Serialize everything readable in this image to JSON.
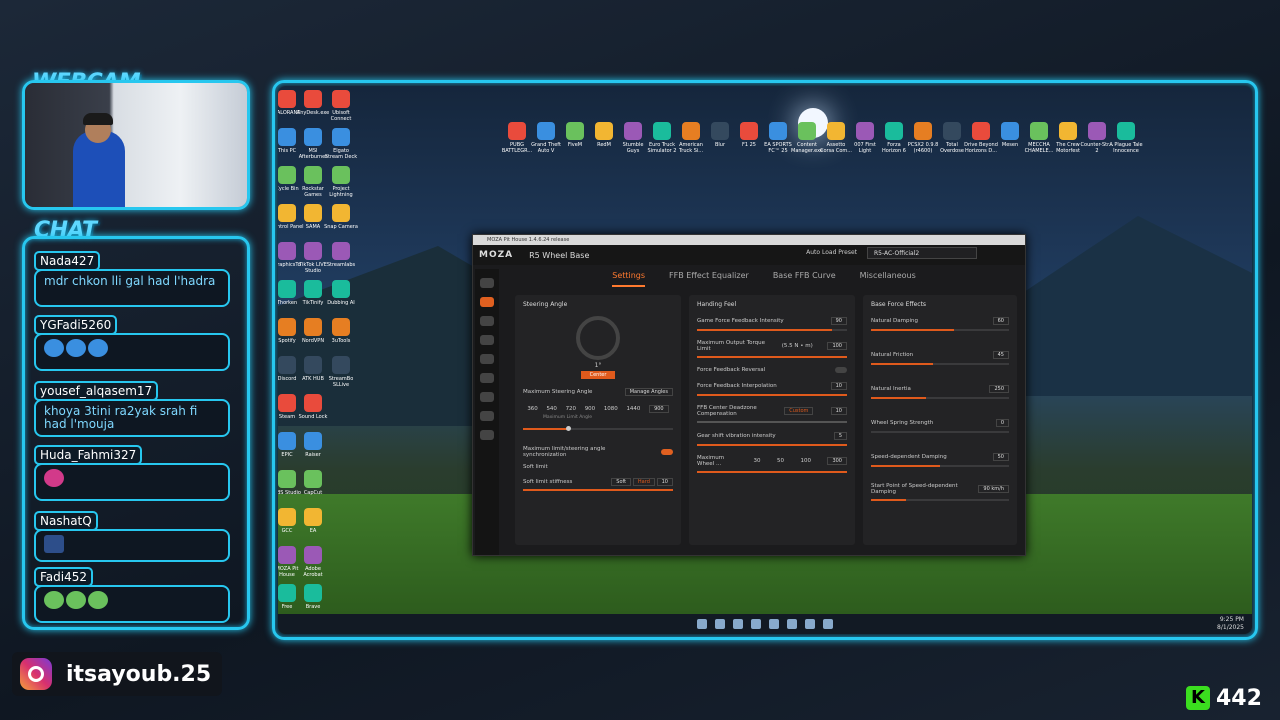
{
  "overlay": {
    "webcam_label": "WEBCAM",
    "chat_label": "CHAT",
    "instagram_handle": "itsayoub.25",
    "kick_count": "442",
    "accent": "#27c7ef"
  },
  "chat": [
    {
      "user": "Nada427",
      "text": "mdr chkon lli gal had l'hadra"
    },
    {
      "user": "YGFadi5260",
      "text": ""
    },
    {
      "user": "yousef_alqasem17",
      "text": "khoya 3tini ra2yak srah fi had l'mouja"
    },
    {
      "user": "Huda_Fahmi327",
      "text": ""
    },
    {
      "user": "NashatQ",
      "text": ""
    },
    {
      "user": "Fadi452",
      "text": ""
    }
  ],
  "desktop_left_icons": [
    "VALORANT",
    "This PC",
    "Cycle Bin",
    "Control Panel",
    "GraphicsTo",
    "Thorken",
    "Spotify",
    "Discord",
    "Steam",
    "EPIC",
    "OBS Studio",
    "GCC",
    "MOZA Pit House",
    "Free"
  ],
  "desktop_col2_icons": [
    "AnyDesk.exe",
    "MSI Afterburner",
    "Rockstar Games",
    "SAMA",
    "TikTok LIVE Studio",
    "TikTinify",
    "NordVPN",
    "ATK HUB",
    "Sound Lock",
    "Raiser",
    "CapCut",
    "EA",
    "Adobe Acrobat",
    "Brave"
  ],
  "desktop_col3_icons": [
    "Ubisoft Connect",
    "Elgato Stream Deck",
    "Project Lightning",
    "Snap Camera",
    "Streamlabs",
    "Dubbing AI",
    "3uTools",
    "StreamBo SLLive"
  ],
  "desktop_top_icons": [
    "PUBG BATTLEGR...",
    "Grand Theft Auto V",
    "FiveM",
    "RedM",
    "Stumble Guys",
    "Euro Truck Simulator 2",
    "American Truck Si...",
    "Blur",
    "F1 25",
    "EA SPORTS FC™ 25",
    "Content Manager.exe",
    "Assetto Corsa Com...",
    "007 First Light",
    "Forza Horizon 6",
    "PCSX2 0.9.8 (r4600)",
    "Total Overdose",
    "Drive Beyond Horizons D...",
    "Mesen",
    "MECCHA CHAMELE...",
    "The Crew Motorfest",
    "Counter-Str... 2",
    "A Plague Tale Innocence"
  ],
  "app": {
    "window_title": "MOZA Pit House 1.4.6.24 release",
    "logo": "MOZA",
    "device": "R5 Wheel Base",
    "auto_load_label": "Auto Load Preset",
    "preset": "R5-AC-Official2",
    "tabs": [
      "Settings",
      "FFB Effect Equalizer",
      "Base FFB Curve",
      "Miscellaneous"
    ],
    "steering": {
      "title": "Steering Angle",
      "angle": "1°",
      "center_btn": "Center",
      "max_label": "Maximum Steering Angle",
      "manage": "Manage Angles",
      "presets": [
        "360",
        "540",
        "720",
        "900",
        "1080",
        "1440",
        "900"
      ],
      "tooltip": "Maximum Limit Angle",
      "sync_label": "Maximum limit/steering angle synchronization",
      "soft_limit": "Soft limit",
      "soft_stiff": "Soft limit stiffness",
      "soft_opt": "Soft",
      "hard_opt": "Hard",
      "soft_val": "10",
      "max_angle_level": 0.3
    },
    "handing": {
      "title": "Handing Feel",
      "game_ffb": "Game Force Feedback Intensity",
      "game_ffb_val": "90",
      "game_ffb_level": 0.9,
      "max_torque": "Maximum Output Torque Limit",
      "max_torque_val": "(5.5 N • m)",
      "max_torque_num": "100",
      "max_torque_level": 1.0,
      "reversal": "Force Feedback Reversal",
      "interp": "Force Feedback Interpolation",
      "interp_val": "10",
      "interp_level": 1.0,
      "deadzone": "FFB Center Deadzone Compensation",
      "deadzone_opt": "Custom",
      "deadzone_val": "10",
      "deadzone_level": 1.0,
      "gear": "Gear shift vibration intensity",
      "gear_val": "5",
      "gear_level": 1.0,
      "max_wheel": "Maximum Wheel ...",
      "max_wheel_opts": [
        "30",
        "50",
        "100",
        "300"
      ],
      "max_wheel_level": 1.0
    },
    "base": {
      "title": "Base Force Effects",
      "damping": "Natural Damping",
      "damping_val": "60",
      "damping_level": 0.6,
      "friction": "Natural Friction",
      "friction_val": "45",
      "friction_level": 0.45,
      "inertia": "Natural Inertia",
      "inertia_val": "250",
      "inertia_level": 0.4,
      "spring": "Wheel Spring Strength",
      "spring_val": "0",
      "spring_level": 0.0,
      "speed_damp": "Speed-dependent Damping",
      "speed_damp_val": "50",
      "speed_damp_level": 0.5,
      "start_point": "Start Point of Speed-dependent Damping",
      "start_point_val": "90 km/h",
      "start_point_level": 0.25
    }
  },
  "taskbar": {
    "time": "9:25 PM",
    "date": "8/1/2025"
  }
}
